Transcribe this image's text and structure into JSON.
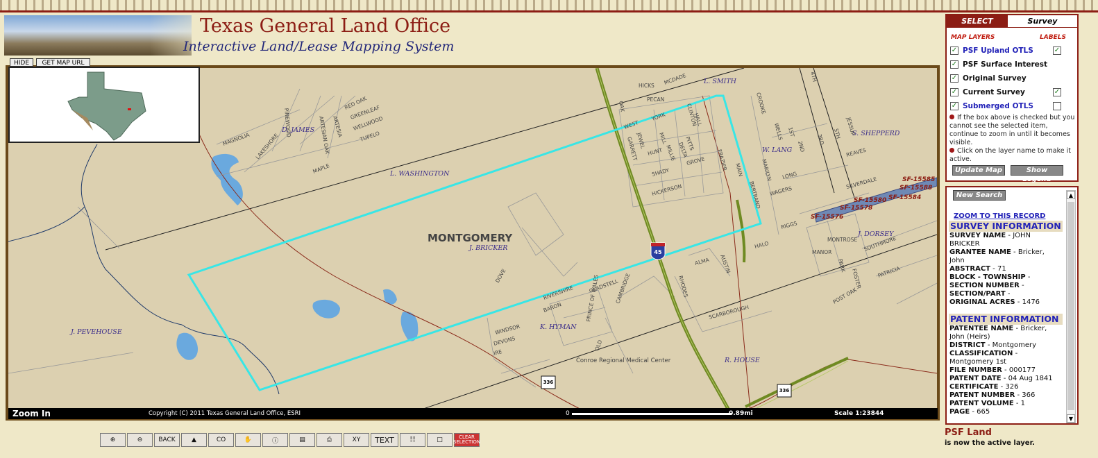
{
  "header": {
    "title": "Texas General Land Office",
    "subtitle": "Interactive Land/Lease Mapping System"
  },
  "map_controls": {
    "hide_label": "HIDE",
    "get_url_label": "GET MAP URL"
  },
  "map": {
    "county": "MONTGOMERY",
    "survey_labels": [
      "D. JAMES",
      "L. WASHINGTON",
      "J. BRICKER",
      "J. PEVEHOUSE",
      "K. HYMAN",
      "L. SMITH",
      "W. LANG",
      "S. SHEPPERD",
      "J. DORSEY",
      "R. HOUSE"
    ],
    "landmark": "Conroe Regional Medical Center",
    "interstate": "45",
    "state_route": "336",
    "psf_parcels": [
      "SF-15585",
      "SF-15588",
      "SF-15580",
      "SF-15584",
      "SF-15578",
      "SF-15576"
    ],
    "streets": [
      "MAGNOLIA",
      "LAKESHORE",
      "MAPLE",
      "PINEWOOD",
      "ARTESIAN OAK",
      "ARTESIA",
      "RED OAK",
      "GREENLEAF",
      "WELLWOOD",
      "TUPELO",
      "HICKS",
      "MCDADE",
      "PECAN",
      "YORK",
      "OAK",
      "WEST",
      "JEWEL",
      "GARRETT",
      "HUNT",
      "MILL",
      "MILLIE",
      "DELTA",
      "PITTS",
      "HALL",
      "CLINTON",
      "GROVE",
      "SHADY",
      "HICKERSON",
      "FRAZIER",
      "MAIN",
      "BERTRAND",
      "CROOKE",
      "WELLS",
      "1ST",
      "2ND",
      "3RD",
      "4TH",
      "5TH",
      "JESSUP",
      "REAVES",
      "SILVERDALE",
      "WAGERS",
      "LONG",
      "MARILYN",
      "RIGGS",
      "HALO",
      "MONTROSE",
      "MANOR",
      "PARK",
      "FOSTER",
      "SOUTHMORE",
      "PATRICIA",
      "POST OAK",
      "ALMA",
      "AUSTIN",
      "RHODES",
      "SCARBOROUGH",
      "CAMBRIDGE",
      "GLADSTELL",
      "RIVERSHIRE",
      "BARON",
      "PRINCE OF WALES",
      "OLD",
      "DOVE",
      "WINDSOR",
      "DEVONS",
      "IRE"
    ]
  },
  "status": {
    "mode": "Zoom In",
    "copyright": "Copyright (C) 2011 Texas General Land Office, ESRI",
    "scale_start": "0",
    "scale_distance": "0.89mi",
    "scale_ratio": "Scale 1:23844"
  },
  "toolbar": {
    "zoom_in": "zoom-in-icon",
    "zoom_out": "zoom-out-icon",
    "back": "BACK",
    "full_extent": "texas-icon",
    "coord": "CO",
    "pan": "hand-icon",
    "identify": "info-icon",
    "measure": "ruler-icon",
    "print": "printer-icon",
    "xy": "XY",
    "text": "TEXT",
    "grid": "grid-icon",
    "select": "select-icon",
    "clear": "CLEAR SELECTION"
  },
  "panel": {
    "tab_select": "SELECT",
    "tab_survey": "Survey",
    "hdr_layers": "MAP LAYERS",
    "hdr_labels": "LABELS",
    "layers": [
      {
        "name": "PSF Upland OTLS",
        "checked": true,
        "label_checked": true,
        "label_box": true,
        "active": true
      },
      {
        "name": "PSF Surface Interest",
        "checked": true,
        "label_box": false,
        "active": false
      },
      {
        "name": "Original Survey",
        "checked": true,
        "label_box": false,
        "active": false
      },
      {
        "name": "Current Survey",
        "checked": true,
        "label_checked": true,
        "label_box": true,
        "active": false
      },
      {
        "name": "Submerged OTLS",
        "checked": true,
        "label_checked": false,
        "label_box": true,
        "active": true
      }
    ],
    "note1": "If the box above is checked but you cannot see the selected item, continue to zoom in until it becomes visible.",
    "note2": "Click on the layer name to make it active.",
    "update_btn": "Update Map",
    "legend_btn": "Show Legend"
  },
  "results": {
    "new_search": "New Search",
    "zoom_link": "ZOOM TO THIS RECORD",
    "survey_header": "SURVEY INFORMATION",
    "survey_fields": [
      {
        "k": "SURVEY NAME",
        "v": "JOHN BRICKER"
      },
      {
        "k": "GRANTEE NAME",
        "v": "Bricker, John"
      },
      {
        "k": "ABSTRACT",
        "v": "71"
      },
      {
        "k": "BLOCK - TOWNSHIP",
        "v": ""
      },
      {
        "k": "SECTION NUMBER",
        "v": ""
      },
      {
        "k": "SECTION/PART",
        "v": ""
      },
      {
        "k": "ORIGINAL ACRES",
        "v": "1476"
      }
    ],
    "patent_header": "PATENT INFORMATION",
    "patent_fields": [
      {
        "k": "PATENTEE NAME",
        "v": "Bricker, John (Heirs)"
      },
      {
        "k": "DISTRICT",
        "v": "Montgomery"
      },
      {
        "k": "CLASSIFICATION",
        "v": "Montgomery 1st"
      },
      {
        "k": "FILE NUMBER",
        "v": "000177"
      },
      {
        "k": "PATENT DATE",
        "v": "04 Aug 1841"
      },
      {
        "k": "CERTIFICATE",
        "v": "326"
      },
      {
        "k": "PATENT NUMBER",
        "v": "366"
      },
      {
        "k": "PATENT VOLUME",
        "v": "1"
      },
      {
        "k": "PAGE",
        "v": "665"
      }
    ]
  },
  "footer": {
    "active_layer": "PSF Land",
    "active_msg": "is now the active layer."
  },
  "colors": {
    "brand_red": "#8c1d14",
    "survey_outline": "#38e6e6",
    "water": "#6aa9de",
    "land": "#dcd0b0",
    "highway": "#6f8a22"
  }
}
